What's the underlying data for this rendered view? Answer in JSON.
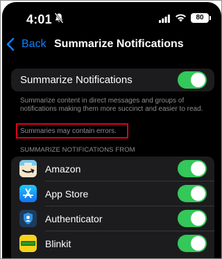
{
  "status_bar": {
    "time": "4:01",
    "battery": "80",
    "icons": [
      "bell-slash-icon",
      "cellular-signal-icon",
      "wifi-icon",
      "battery-icon"
    ]
  },
  "nav": {
    "back_label": "Back",
    "title": "Summarize Notifications"
  },
  "main_toggle": {
    "label": "Summarize Notifications",
    "on": true
  },
  "description": "Summarize content in direct messages and groups of notifications making them more succinct and easier to read.",
  "warning": "Summaries may contain errors.",
  "section_header": "SUMMARIZE NOTIFICATIONS FROM",
  "apps": [
    {
      "name": "Amazon",
      "icon": "amazon-app-icon",
      "on": true
    },
    {
      "name": "App Store",
      "icon": "app-store-icon",
      "on": true
    },
    {
      "name": "Authenticator",
      "icon": "authenticator-icon",
      "on": true
    },
    {
      "name": "Blinkit",
      "icon": "blinkit-icon",
      "on": true
    }
  ],
  "colors": {
    "accent_blue": "#0a84ff",
    "toggle_green": "#34c759",
    "highlight_red": "#e0001b",
    "background": "#000000",
    "card": "#1c1c1e",
    "secondary_text": "#8e8e93"
  }
}
